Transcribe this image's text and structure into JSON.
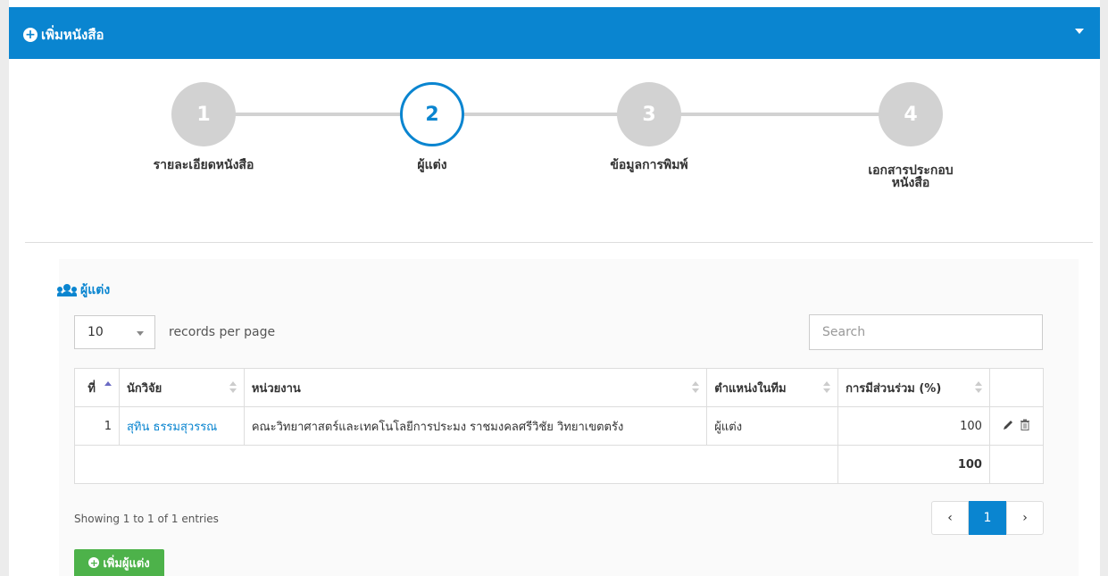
{
  "header": {
    "title": "เพิ่มหนังสือ",
    "plus_icon": "+"
  },
  "wizard": {
    "steps": [
      {
        "number": "1",
        "label": "รายละเอียดหนังสือ",
        "active": false
      },
      {
        "number": "2",
        "label": "ผู้แต่ง",
        "active": true
      },
      {
        "number": "3",
        "label": "ข้อมูลการพิมพ์",
        "active": false
      },
      {
        "number": "4",
        "label_line1": "เอกสารประกอบ",
        "label_line2": "หนังสือ",
        "active": false
      }
    ]
  },
  "authors_box": {
    "title": "ผู้แต่ง",
    "icon": "users-icon",
    "length": {
      "value": "10",
      "label": "records per page"
    },
    "search": {
      "placeholder": "Search"
    },
    "columns": [
      "ที่",
      "นักวิจัย",
      "หน่วยงาน",
      "ตำแหน่งในทีม",
      "การมีส่วนร่วม (%)"
    ],
    "rows": [
      {
        "no": "1",
        "researcher": "สุทิน ธรรมสุวรรณ",
        "department": "คณะวิทยาศาสตร์และเทคโนโลยีการประมง ราชมงคลศรีวิชัย วิทยาเขตตรัง",
        "role": "ผู้แต่ง",
        "percent": "100"
      }
    ],
    "total": "100",
    "info": "Showing 1 to 1 of 1 entries",
    "pager": {
      "prev": "‹",
      "current": "1",
      "next": "›"
    },
    "add_button": "เพิ่มผู้แต่ง"
  },
  "colors": {
    "primary": "#0a85d0",
    "success": "#4db24a",
    "step_inactive": "#d2d2d2"
  }
}
